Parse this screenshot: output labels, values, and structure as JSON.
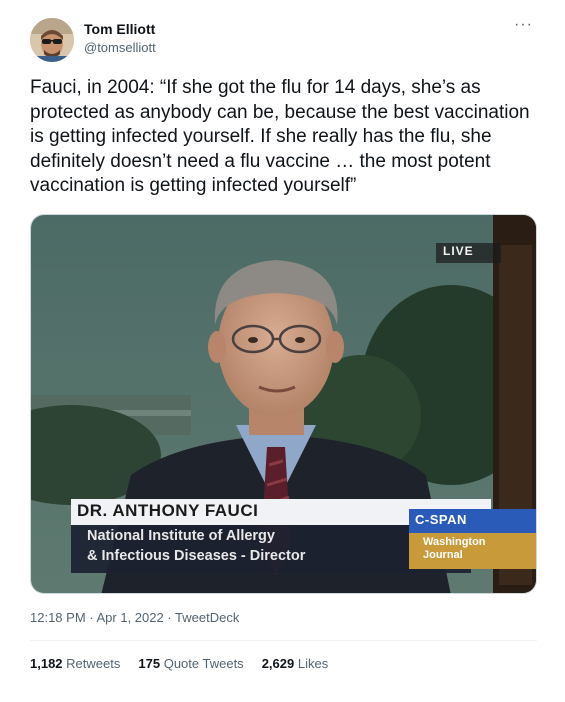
{
  "author": {
    "name": "Tom Elliott",
    "handle": "@tomselliott"
  },
  "more_label": "···",
  "tweet_text": "Fauci, in 2004: “If she got the flu for 14 days, she’s as protected as anybody can be, because the best vaccination is getting infected yourself. If she really has the flu, she definitely doesn’t need a flu vaccine … the most potent vaccination is getting infected yourself”",
  "media": {
    "live_label": "LIVE",
    "lower_third": {
      "name": "DR. ANTHONY FAUCI",
      "line1": "National Institute of Allergy",
      "line2": "& Infectious Diseases - Director"
    },
    "network": "C-SPAN",
    "program_line1": "Washington",
    "program_line2": "Journal"
  },
  "meta": {
    "time": "12:18 PM",
    "sep1": " · ",
    "date": "Apr 1, 2022",
    "sep2": " · ",
    "source": "TweetDeck"
  },
  "stats": {
    "retweets_count": "1,182",
    "retweets_label": "Retweets",
    "quotes_count": "175",
    "quotes_label": "Quote Tweets",
    "likes_count": "2,629",
    "likes_label": "Likes"
  },
  "colors": {
    "text": "#0f1419",
    "muted": "#536471",
    "cspan_blue": "#2a5bb8",
    "lower_third_bg": "#eef0f4"
  }
}
